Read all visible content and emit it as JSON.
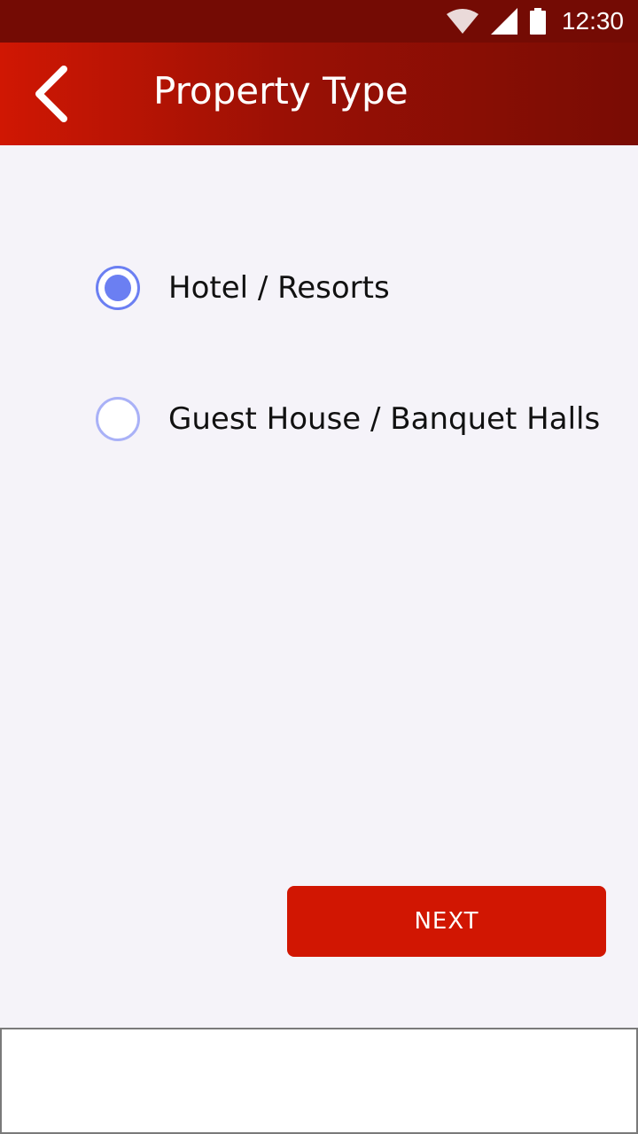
{
  "status_bar": {
    "time": "12:30",
    "icons": [
      "wifi-icon",
      "signal-icon",
      "battery-icon"
    ]
  },
  "app_bar": {
    "title": "Property Type",
    "back_icon": "chevron-left-icon"
  },
  "options": [
    {
      "label": "Hotel / Resorts",
      "selected": true
    },
    {
      "label": "Guest House / Banquet Halls",
      "selected": false
    }
  ],
  "actions": {
    "next_label": "NEXT"
  },
  "colors": {
    "status_bar": "#740b04",
    "app_bar_start": "#d01703",
    "app_bar_end": "#790c04",
    "accent": "#6b7ff2",
    "button": "#d11602",
    "background": "#f5f3f9"
  }
}
